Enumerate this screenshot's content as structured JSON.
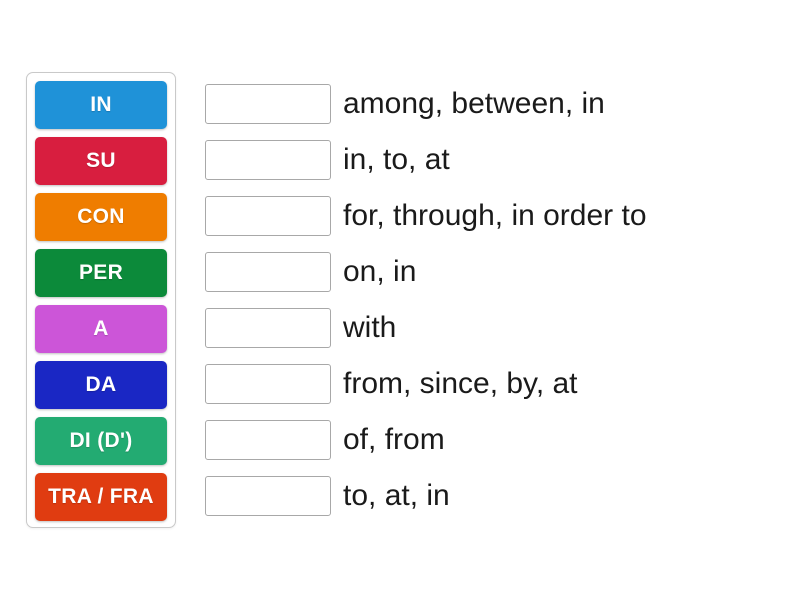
{
  "activity": {
    "type": "match-up",
    "background_color": "#ffffff"
  },
  "tile_tray": {
    "border_color": "#c9c9c9",
    "tiles": [
      {
        "label": "IN",
        "color": "#1f92d8"
      },
      {
        "label": "SU",
        "color": "#d81e3f"
      },
      {
        "label": "CON",
        "color": "#ef7d00"
      },
      {
        "label": "PER",
        "color": "#0c8a3a"
      },
      {
        "label": "A",
        "color": "#cc55d8"
      },
      {
        "label": "DA",
        "color": "#1a27c4"
      },
      {
        "label": "DI (D')",
        "color": "#23ab72"
      },
      {
        "label": "TRA / FRA",
        "color": "#e03c11"
      }
    ]
  },
  "pairs": {
    "dropzone_border_color": "#a8a8a8",
    "rows": [
      {
        "dropzone_value": "",
        "definition": "among, between, in"
      },
      {
        "dropzone_value": "",
        "definition": "in, to, at"
      },
      {
        "dropzone_value": "",
        "definition": "for, through, in order to"
      },
      {
        "dropzone_value": "",
        "definition": "on, in"
      },
      {
        "dropzone_value": "",
        "definition": "with"
      },
      {
        "dropzone_value": "",
        "definition": "from, since, by, at"
      },
      {
        "dropzone_value": "",
        "definition": "of, from"
      },
      {
        "dropzone_value": "",
        "definition": "to, at, in"
      }
    ]
  }
}
